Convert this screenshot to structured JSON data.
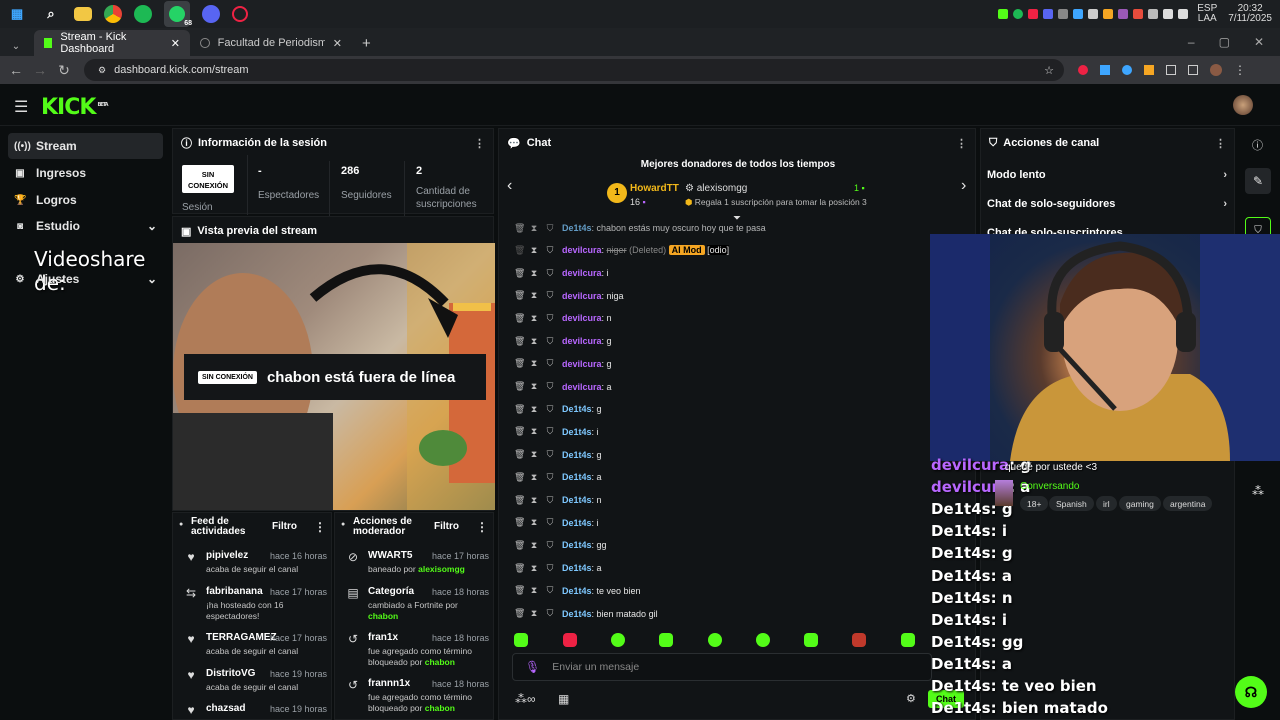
{
  "taskbar": {
    "icons": [
      "windows-icon",
      "search-icon",
      "folder-icon",
      "chrome-icon",
      "spotify-icon",
      "whatsapp-icon",
      "discord-icon",
      "app-icon"
    ],
    "whatsapp_badge": "68",
    "lang_top": "ESP",
    "lang_bottom": "LAA",
    "time": "20:32",
    "date": "7/11/2025"
  },
  "browser": {
    "tabs": [
      {
        "label": "Stream - Kick Dashboard",
        "active": true
      },
      {
        "label": "Facultad de Periodismo - ¡En Vi",
        "active": false
      }
    ],
    "url": "dashboard.kick.com/stream"
  },
  "app": {
    "logo": "KICK",
    "logo_sup": "BETA"
  },
  "sidebar": {
    "items": [
      {
        "label": "Stream",
        "icon": "broadcast-icon",
        "active": true
      },
      {
        "label": "Ingresos",
        "icon": "wallet-icon",
        "active": false
      },
      {
        "label": "Logros",
        "icon": "trophy-icon",
        "active": false
      },
      {
        "label": "Estudio",
        "icon": "studio-icon",
        "active": false
      },
      {
        "label": "Ajustes",
        "icon": "gear-icon",
        "active": false
      }
    ],
    "overlay_text": "Videoshare de:"
  },
  "session": {
    "title": "Información de la sesión",
    "status_badge_1": "SIN",
    "status_badge_2": "CONEXIÓN",
    "status_label": "Sesión",
    "stats": [
      {
        "value": "-",
        "label": "Espectadores"
      },
      {
        "value": "286",
        "label": "Seguidores"
      },
      {
        "value": "2",
        "label": "Cantidad de suscripciones"
      }
    ]
  },
  "preview": {
    "title": "Vista previa del stream",
    "badge": "SIN CONEXIÓN",
    "message": "chabon está fuera de línea"
  },
  "activity": {
    "title": "Feed de actividades",
    "filter": "Filtro",
    "items": [
      {
        "name": "pipivelez",
        "time": "hace 16 horas",
        "desc": "acaba de seguir el canal",
        "icon": "heart-icon"
      },
      {
        "name": "fabribanana",
        "time": "hace 17 horas",
        "desc": "¡ha hosteado con 16 espectadores!",
        "icon": "host-icon"
      },
      {
        "name": "TERRAGAMEZ",
        "time": "hace 17 horas",
        "desc": "acaba de seguir el canal",
        "icon": "heart-icon"
      },
      {
        "name": "DistritoVG",
        "time": "hace 19 horas",
        "desc": "acaba de seguir el canal",
        "icon": "heart-icon"
      },
      {
        "name": "chazsad",
        "time": "hace 19 horas",
        "desc": "",
        "icon": "heart-icon"
      }
    ]
  },
  "modactions": {
    "title": "Acciones de moderador",
    "filter": "Filtro",
    "items": [
      {
        "name": "WWART5",
        "time": "hace 17 horas",
        "desc": "baneado por ",
        "by": "alexisomgg",
        "icon": "ban-icon"
      },
      {
        "name": "Categoría",
        "time": "hace 18 horas",
        "desc": "cambiado a Fortnite por ",
        "by": "chabon",
        "icon": "category-icon"
      },
      {
        "name": "fran1x",
        "time": "hace 18 horas",
        "desc": "fue agregado como término bloqueado por ",
        "by": "chabon",
        "icon": "undo-icon"
      },
      {
        "name": "frannn1x",
        "time": "hace 18 horas",
        "desc": "fue agregado como término bloqueado por ",
        "by": "chabon",
        "icon": "undo-icon"
      }
    ]
  },
  "chat": {
    "title": "Chat",
    "donors_title": "Mejores donadores de todos los tiempos",
    "top_donor": {
      "rank": "1",
      "name": "HowardTT",
      "count": "16"
    },
    "second_donor": {
      "name": "alexisomgg",
      "count": "1"
    },
    "gift_prompt": "Regala 1 suscripción para tomar la posición 3",
    "top_message": {
      "user": "De1t4s",
      "text": ": chabon estás muy oscuro hoy que te pasa"
    },
    "deleted_message": {
      "user": "devilcura",
      "text": "niger",
      "deleted": "(Deleted)",
      "ai_tag": "AI Mod",
      "reason": "[odio]"
    },
    "messages": [
      {
        "user": "devilcura",
        "text": ": i",
        "color": "purple"
      },
      {
        "user": "devilcura",
        "text": ": niga",
        "color": "purple"
      },
      {
        "user": "devilcura",
        "text": ": n",
        "color": "purple"
      },
      {
        "user": "devilcura",
        "text": ": g",
        "color": "purple"
      },
      {
        "user": "devilcura",
        "text": ": g",
        "color": "purple"
      },
      {
        "user": "devilcura",
        "text": ": a",
        "color": "purple"
      },
      {
        "user": "De1t4s",
        "text": ": g",
        "color": "blue"
      },
      {
        "user": "De1t4s",
        "text": ": i",
        "color": "blue"
      },
      {
        "user": "De1t4s",
        "text": ": g",
        "color": "blue"
      },
      {
        "user": "De1t4s",
        "text": ": a",
        "color": "blue"
      },
      {
        "user": "De1t4s",
        "text": ": n",
        "color": "blue"
      },
      {
        "user": "De1t4s",
        "text": ": i",
        "color": "blue"
      },
      {
        "user": "De1t4s",
        "text": ": gg",
        "color": "blue"
      },
      {
        "user": "De1t4s",
        "text": ": a",
        "color": "blue"
      },
      {
        "user": "De1t4s",
        "text": ": te veo bien",
        "color": "blue"
      },
      {
        "user": "De1t4s",
        "text": ": bien matado gil",
        "color": "blue"
      }
    ],
    "input_placeholder": "Enviar un mensaje",
    "send_label": "Chat"
  },
  "channel_actions": {
    "title": "Acciones de canal",
    "items": [
      "Modo lento",
      "Chat de solo-seguidores",
      "Chat de solo-suscriptores"
    ]
  },
  "overlay": {
    "lines": [
      {
        "user": "devilcura",
        "text": ": g",
        "purple": true
      },
      {
        "user": "devilcura",
        "text": ": a",
        "purple": true
      },
      {
        "user": "De1t4s",
        "text": ": g",
        "purple": false
      },
      {
        "user": "De1t4s",
        "text": ": i",
        "purple": false
      },
      {
        "user": "De1t4s",
        "text": ": g",
        "purple": false
      },
      {
        "user": "De1t4s",
        "text": ": a",
        "purple": false
      },
      {
        "user": "De1t4s",
        "text": ": n",
        "purple": false
      },
      {
        "user": "De1t4s",
        "text": ": i",
        "purple": false
      },
      {
        "user": "De1t4s",
        "text": ": gg",
        "purple": false
      },
      {
        "user": "De1t4s",
        "text": ": a",
        "purple": false
      },
      {
        "user": "De1t4s",
        "text": ": te veo bien",
        "purple": false
      },
      {
        "user": "De1t4s",
        "text": ": bien matado",
        "purple": false
      }
    ],
    "quedo_text": "quedé por ustede <3",
    "category": "Conversando",
    "tags": [
      "18+",
      "Spanish",
      "irl",
      "gaming",
      "argentina"
    ]
  },
  "colors": {
    "accent": "#53fc18",
    "purple": "#b867ff",
    "blue": "#7ec8ff"
  }
}
